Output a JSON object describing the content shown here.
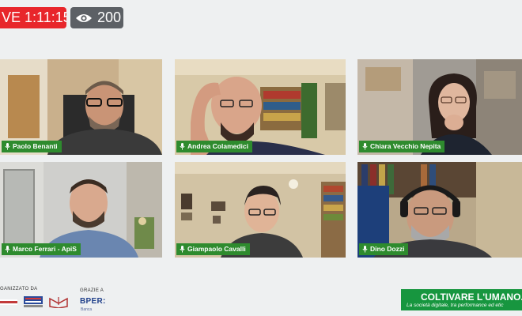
{
  "top_bar": {
    "live_label": "VE 1:11:15",
    "viewer_count": "200"
  },
  "participants": [
    {
      "name": "Paolo Benanti"
    },
    {
      "name": "Andrea Colamedici"
    },
    {
      "name": "Chiara Vecchio Nepita"
    },
    {
      "name": "Marco Ferrari - ApiS"
    },
    {
      "name": "Giampaolo Cavalli"
    },
    {
      "name": "Dino Dozzi"
    }
  ],
  "footer": {
    "organized_by": "GANIZZATO DA",
    "thanks_to": "GRAZIE A",
    "sponsor": "BPER:",
    "sponsor_sub": "Banca",
    "banner_title": "COLTIVARE L'UMANO.",
    "banner_subtitle": "La società digitale, tra performance ed etic"
  },
  "colors": {
    "live_red": "#e8262b",
    "name_tag_green": "#2e8b2e",
    "banner_green": "#17963f"
  }
}
